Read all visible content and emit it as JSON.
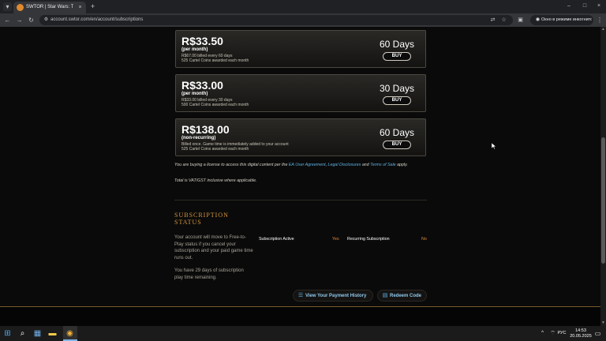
{
  "browser": {
    "tab_title": "SWTOR | Star Wars: The Old R...",
    "tab_close": "×",
    "new_tab": "+",
    "url": "account.swtor.com/en/account/subscriptions",
    "incognito_label": "Окно в режиме инкогнито",
    "window_controls": [
      "–",
      "□",
      "×"
    ]
  },
  "plans": [
    {
      "price": "R$33.50",
      "period": "(per month)",
      "detail_1": "R$67.00 billed every 60 days",
      "detail_2": "525 Cartel Coins awarded each month",
      "days": "60 Days",
      "buy_label": "BUY"
    },
    {
      "price": "R$33.00",
      "period": "(per month)",
      "detail_1": "R$33.00 billed every 30 days",
      "detail_2": "500 Cartel Coins awarded each month",
      "days": "30 Days",
      "buy_label": "BUY"
    },
    {
      "price": "R$138.00",
      "period": "(non-recurring)",
      "detail_1": "Billed once. Game time is immediately added to your account",
      "detail_2": "525 Cartel Coins awarded each month",
      "days": "60 Days",
      "buy_label": "BUY"
    }
  ],
  "legal": {
    "prefix": "You are buying a license to access this digital content per the ",
    "link_eula": "EA User Agreement",
    "sep_1": ", ",
    "link_disclosures": "Legal Disclosures",
    "sep_2": " and ",
    "link_terms": "Terms of Sale",
    "suffix": " apply.",
    "vat_note": "Total is VAT/GST inclusive where applicable."
  },
  "subscription_status": {
    "title_line_1": "SUBSCRIPTION",
    "title_line_2": "STATUS",
    "text_1": "Your account will move to Free-to-Play status if you cancel your subscription and your paid game time runs out.",
    "text_2": "You have 29 days of subscription play time remaining.",
    "active_label": "Subscription Active",
    "active_value": "Yes",
    "recurring_label": "Recurring Subscription",
    "recurring_value": "No",
    "payment_history_label": "View Your Payment History",
    "redeem_code_label": "Redeem Code"
  },
  "taskbar": {
    "lang": "РУС",
    "time": "14:53",
    "date": "20.05.2025"
  },
  "colors": {
    "accent_orange": "#d4953c",
    "link_blue": "#5fb1e0",
    "page_bg": "#0a0a0a"
  },
  "icons": [
    "search-icon",
    "star-icon",
    "translate-icon",
    "extensions-icon",
    "incognito-icon",
    "history-icon",
    "redeem-icon",
    "windows-icon"
  ]
}
